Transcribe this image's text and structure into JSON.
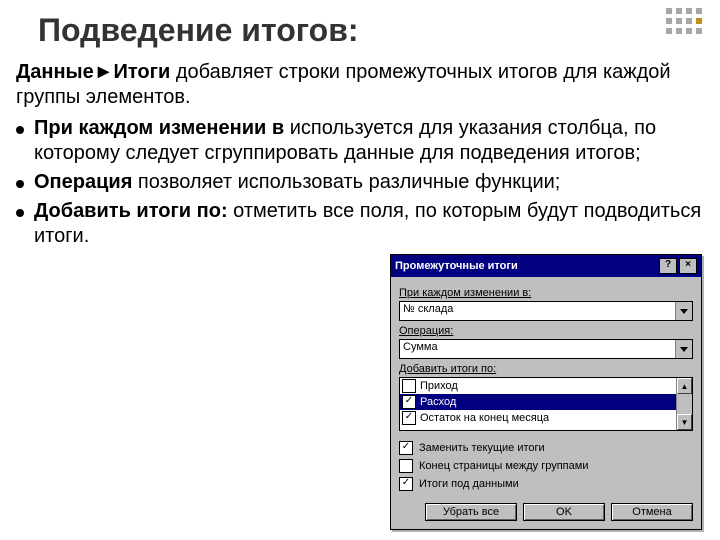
{
  "title": "Подведение итогов:",
  "lead": {
    "bold": "Данные►Итоги",
    "text": " добавляет строки промежуточных итогов для каждой группы элементов."
  },
  "items": [
    {
      "bold": "При каждом изменении в",
      "text": " используется для указания столбца, по которому следует сгруппировать данные для подведения итогов;"
    },
    {
      "bold": "Операция",
      "text": " позволяет использовать различные функции;"
    },
    {
      "bold": "Добавить итоги по:",
      "text": " отметить все поля, по которым будут подводиться итоги."
    }
  ],
  "dialog": {
    "title": "Промежуточные итоги",
    "help": "?",
    "close": "×",
    "label_change": "При каждом изменении в:",
    "combo_change": "№ склада",
    "label_op": "Операция:",
    "combo_op": "Сумма",
    "label_add": "Добавить итоги по:",
    "listbox": [
      {
        "label": "Приход",
        "checked": false,
        "selected": false
      },
      {
        "label": "Расход",
        "checked": true,
        "selected": true
      },
      {
        "label": "Остаток на конец месяца",
        "checked": true,
        "selected": false
      }
    ],
    "options": [
      {
        "label": "Заменить текущие итоги",
        "checked": true
      },
      {
        "label": "Конец страницы между группами",
        "checked": false
      },
      {
        "label": "Итоги под данными",
        "checked": true
      }
    ],
    "btn_remove": "Убрать все",
    "btn_ok": "OK",
    "btn_cancel": "Отмена"
  }
}
